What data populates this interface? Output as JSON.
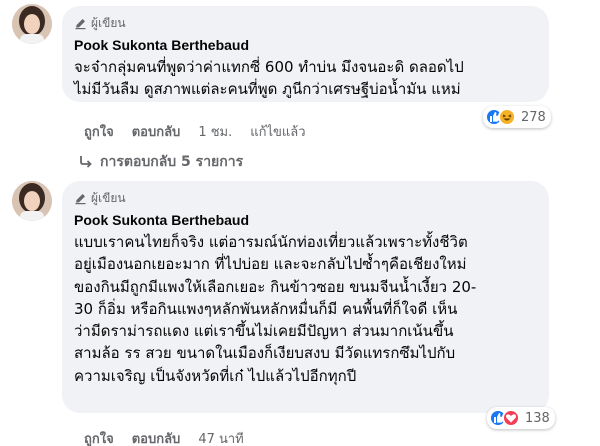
{
  "comments": [
    {
      "badge": "ผู้เขียน",
      "author": "Pook Sukonta Berthebaud",
      "lines": [
        "จะจ๋ากลุ่มคนที่พูดว่าค่าแทกซี่ 600 ทำบ่น มึงจนอะดิ ดลอดไป",
        "ไม่มีวันลืม ดูสภาพแต่ละคนที่พูด ภูนีกว่าเศรษฐีบ่อน้ำมัน แหม่"
      ],
      "actions": {
        "like": "ถูกใจ",
        "reply": "ตอบกลับ",
        "time": "1 ชม.",
        "edited": "แก้ไขแล้ว"
      },
      "reaction_count": "278",
      "replies_label": "การตอบกลับ 5 รายการ"
    },
    {
      "badge": "ผู้เขียน",
      "author": "Pook Sukonta Berthebaud",
      "lines": [
        "แบบเราคนไทยก็จริง แต่อารมณ์นักท่องเที่ยวแล้วเพราะทั้งชีวิต",
        "อยู่เมืองนอกเยอะมาก ที่ไปบ่อย และจะกลับไปซ้ำๆคือเชียงใหม่",
        "ของกินมีถูกมีแพงให้เลือกเยอะ กินข้าวซอย ขนมจีนน้ำเงี้ยว 20-",
        "30 ก็อิ่ม หรือกินแพงๆหลักพันหลักหมื่นก็มี คนพื้นที่ก็ใจดี เห็น",
        "ว่ามีดราม่ารถแดง แต่เราขึ้นไม่เคยมีปัญหา ส่วนมากเน้นขึ้น",
        "สามล้อ รร สวย ขนาดในเมืองก็เงียบสงบ มีวัดแทรกซึมไปกับ",
        "ความเจริญ เป็นจังหวัดที่เก๋ ไปแล้วไปอีกทุกปี"
      ],
      "actions": {
        "like": "ถูกใจ",
        "reply": "ตอบกลับ",
        "time": "47 นาที"
      },
      "reaction_count": "138"
    }
  ],
  "icons": {
    "badge": "pencil-badge-icon",
    "like_reaction": "thumbs-up-icon",
    "haha_reaction": "laughing-face-icon",
    "love_reaction": "heart-icon",
    "replies": "reply-arrow-icon"
  },
  "colors": {
    "bubble": "#f0f2f5",
    "like_blue": "#1877f2",
    "love_red": "#f33e58",
    "haha_yellow": "#f7b125",
    "secondary_text": "#65676b"
  }
}
